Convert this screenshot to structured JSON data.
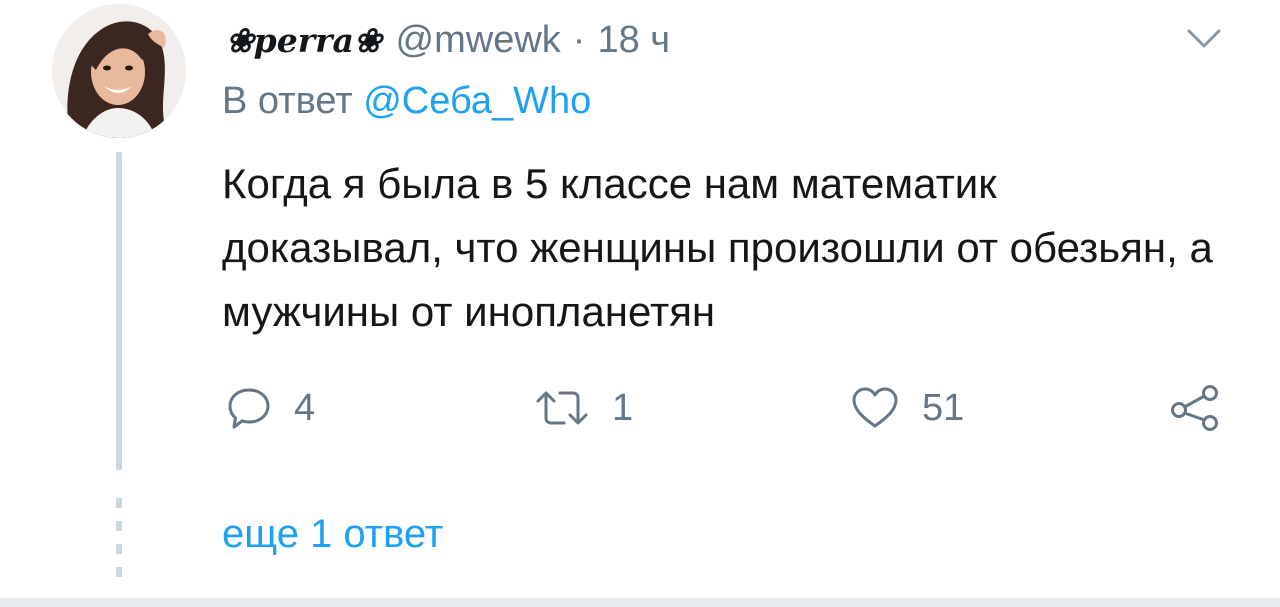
{
  "tweet": {
    "author": {
      "display_name": "❀реrra❀",
      "handle": "@mwewk",
      "avatar_icon": "user-avatar-photo"
    },
    "separator": "·",
    "time": "18 ч",
    "reply_prefix": "В ответ",
    "reply_to_handle": "@Себа_Who",
    "text": "Когда я была в 5 классе нам математик доказывал, что женщины произошли от обезьян, а мужчины от инопланетян",
    "actions": {
      "replies": "4",
      "retweets": "1",
      "likes": "51"
    },
    "more_replies": "еще 1 ответ"
  },
  "colors": {
    "text": "#14171a",
    "secondary": "#657786",
    "link": "#1da1f2",
    "divider": "#ccd6dd"
  },
  "icons": {
    "menu": "chevron-down-icon",
    "reply": "reply-bubble-icon",
    "retweet": "retweet-icon",
    "like": "heart-icon",
    "share": "share-icon"
  }
}
